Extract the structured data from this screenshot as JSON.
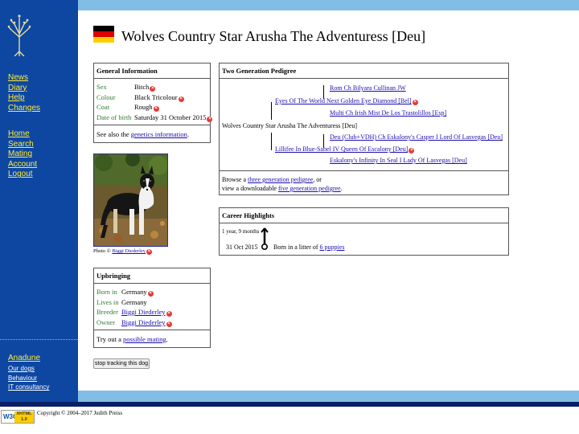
{
  "sidebar": {
    "nav1": [
      "News",
      "Diary",
      "Help",
      "Changes"
    ],
    "nav2": [
      "Home",
      "Search",
      "Mating",
      "Account",
      "Logout"
    ],
    "brand": "Anadune",
    "brand_links": [
      "Our dogs",
      "Behaviour",
      "IT consultancy"
    ]
  },
  "page": {
    "title": "Wolves Country Star Arusha The Adventuress [Deu]",
    "flag": "germany-flag"
  },
  "general": {
    "heading": "General Information",
    "rows": [
      {
        "label": "Sex",
        "value": "Bitch"
      },
      {
        "label": "Colour",
        "value": "Black Tricolour"
      },
      {
        "label": "Coat",
        "value": "Rough"
      },
      {
        "label": "Date of birth",
        "value": "Saturday 31 October 2015"
      }
    ],
    "see_also_prefix": "See also the ",
    "see_also_link": "genetics information",
    "see_also_suffix": "."
  },
  "photo": {
    "caption_prefix": "Photo © ",
    "caption_link": "Biggi Diederley"
  },
  "upbringing": {
    "heading": "Upbringing",
    "rows": [
      {
        "label": "Born in",
        "value": "Germany"
      },
      {
        "label": "Lives in",
        "value": "Germany"
      },
      {
        "label": "Breeder",
        "value": "Biggi Diederley"
      },
      {
        "label": "Owner",
        "value": "Biggi Diederley"
      }
    ],
    "try_prefix": "Try out a ",
    "try_link": "possible mating",
    "try_suffix": "."
  },
  "pedigree": {
    "heading": "Two Generation Pedigree",
    "subject": "Wolves Country Star Arusha The Adventuress [Deu]",
    "sire": "Eyes Of The World Next Golden Eye Diamond [Bel]",
    "dam": "Lillifee In Blue-Sabel IV Queen Of Escalony [Deu]",
    "sire_sire": "Rom Ch Bilyara Cullinan JW",
    "sire_dam": "Multi Ch Irish Mist De Los Trastolillos [Esp]",
    "dam_sire": "Deu (Club+VDH) Ch Eskalony's Casper I Lord Of Lasvegas [Deu]",
    "dam_dam": "Eskalony's Infinity In Seal I Lady Of Lasvegas [Deu]",
    "browse_prefix": "Browse a ",
    "browse_link": "three generation pedigree",
    "browse_mid": ", or",
    "view_prefix": "view a downloadable ",
    "view_link": "five generation pedigree",
    "view_suffix": "."
  },
  "career": {
    "heading": "Career Highlights",
    "age": "1 year, 9 months",
    "date": "31 Oct 2015",
    "event_prefix": "Born in a litter of ",
    "event_link": "6 puppies"
  },
  "button": {
    "label": "stop tracking this dog"
  },
  "footer": {
    "badge_w3c": "W3C",
    "badge_xhtml": "XHTML",
    "badge_version": "1.0",
    "copyright": "Copyright © 2004–2017 Judith Preiss"
  },
  "colors": {
    "sidebar": "#0d47a1",
    "bar": "#82bde6",
    "nav_text": "#ffeb3b",
    "label_green": "#2e7d32",
    "link": "#1a0dab",
    "cross": "#e53935"
  }
}
